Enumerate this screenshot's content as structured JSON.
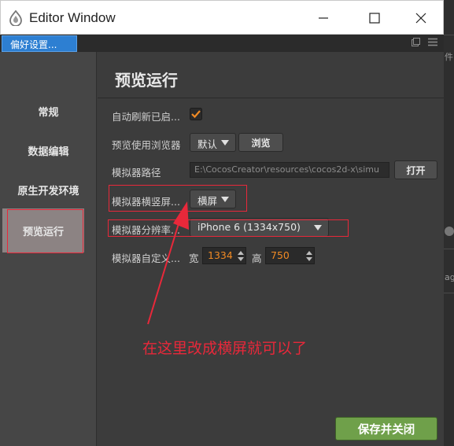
{
  "window": {
    "title": "Editor Window",
    "icon": "cocos-creator-logo-icon"
  },
  "tab": {
    "label": "偏好设置..."
  },
  "nav": {
    "items": [
      {
        "label": "常规",
        "active": false
      },
      {
        "label": "数据编辑",
        "active": false
      },
      {
        "label": "原生开发环境",
        "active": false
      },
      {
        "label": "预览运行",
        "active": true
      }
    ]
  },
  "main": {
    "title": "预览运行",
    "auto_refresh": {
      "label": "自动刷新已启...",
      "checked": true
    },
    "browser": {
      "label": "预览使用浏览器",
      "selected": "默认",
      "browse_label": "浏览"
    },
    "simulator_path": {
      "label": "模拟器路径",
      "value": "E:\\CocosCreator\\resources\\cocos2d-x\\simu",
      "open_label": "打开"
    },
    "orientation": {
      "label": "模拟器横竖屏...",
      "selected": "横屏"
    },
    "resolution": {
      "label": "模拟器分辨率...",
      "selected": "iPhone 6 (1334x750)"
    },
    "custom": {
      "label": "模拟器自定义...",
      "width_label": "宽",
      "width_value": "1334",
      "height_label": "高",
      "height_value": "750"
    },
    "save_label": "保存并关闭"
  },
  "annotation": {
    "text": "在这里改成横屏就可以了",
    "color": "#e8283a"
  },
  "background_fragments": [
    "件",
    "ag"
  ],
  "colors": {
    "accent_tab": "#2d7fd2",
    "save_button": "#6fa04a",
    "checkbox_check": "#f08a24",
    "number_text": "#f08a24"
  }
}
